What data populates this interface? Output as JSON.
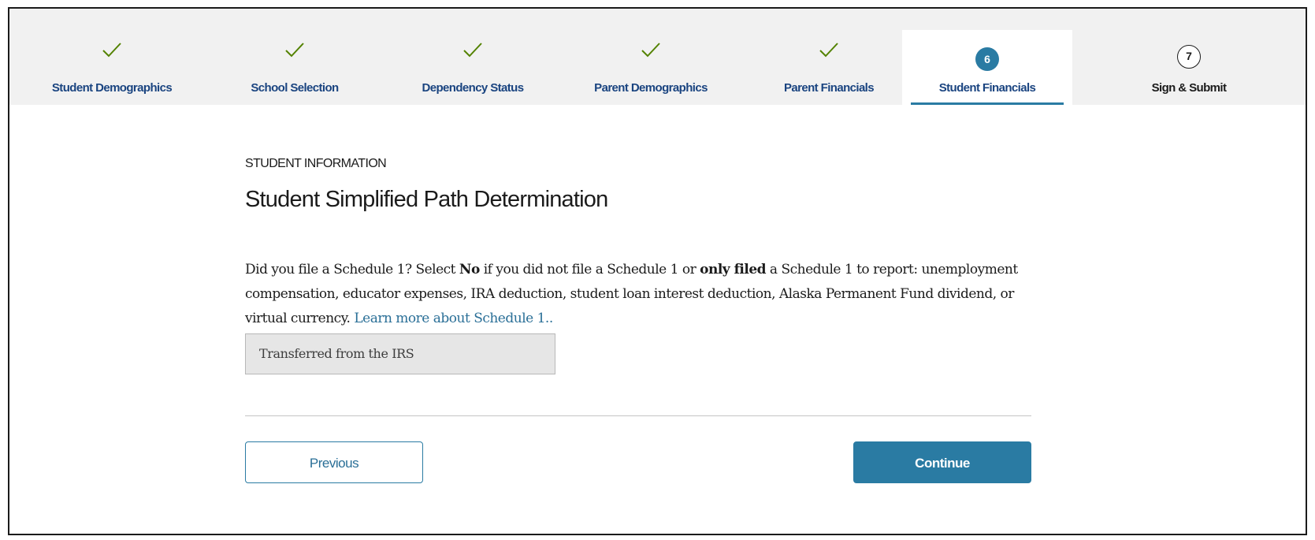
{
  "stepper": {
    "steps": [
      {
        "label": "Student Demographics",
        "status": "complete"
      },
      {
        "label": "School Selection",
        "status": "complete"
      },
      {
        "label": "Dependency Status",
        "status": "complete"
      },
      {
        "label": "Parent Demographics",
        "status": "complete"
      },
      {
        "label": "Parent Financials",
        "status": "complete"
      },
      {
        "label": "Student Financials",
        "status": "active",
        "number": "6"
      },
      {
        "label": "Sign & Submit",
        "status": "upcoming",
        "number": "7"
      }
    ],
    "complete_icon": "checkmark-icon",
    "colors": {
      "accent": "#2a7ba3",
      "step_label": "#1a4480",
      "check": "#538200",
      "stepper_bg": "#f1f1f1"
    }
  },
  "main": {
    "section_label": "STUDENT INFORMATION",
    "title": "Student Simplified Path Determination",
    "question": {
      "part1": "Did you file a Schedule 1? Select ",
      "bold1": "No",
      "part2": " if you did not file a Schedule 1 or ",
      "bold2": "only filed",
      "part3": " a Schedule 1 to report: unemployment compensation, educator expenses, IRA deduction, student loan interest deduction, Alaska Permanent Fund dividend, or virtual currency. ",
      "link": "Learn more about Schedule 1.."
    },
    "answer_value": "Transferred from the IRS"
  },
  "actions": {
    "previous_label": "Previous",
    "continue_label": "Continue"
  }
}
